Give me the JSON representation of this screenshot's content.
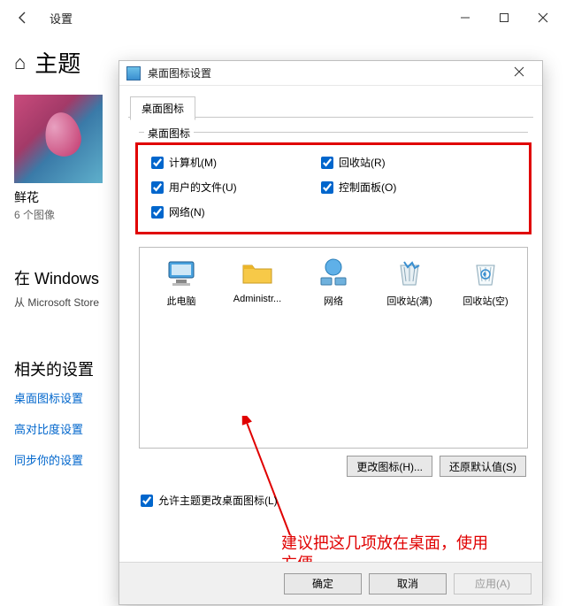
{
  "settings": {
    "title": "设置",
    "page_heading": "主题",
    "thumb_caption": "鲜花",
    "thumb_sub": "6 个图像",
    "section_heading": "在 Windows",
    "section_sub": "从 Microsoft Store",
    "related_heading": "相关的设置",
    "links": {
      "desktop_icons": "桌面图标设置",
      "high_contrast": "高对比度设置",
      "sync": "同步你的设置"
    }
  },
  "dialog": {
    "title": "桌面图标设置",
    "tab": "桌面图标",
    "group_title": "桌面图标",
    "checks": {
      "computer": "计算机(M)",
      "user_files": "用户的文件(U)",
      "network": "网络(N)",
      "recycle_bin": "回收站(R)",
      "control_panel": "控制面板(O)"
    },
    "icon_labels": {
      "this_pc": "此电脑",
      "admin": "Administr...",
      "network": "网络",
      "recycle_full": "回收站(满)",
      "recycle_empty": "回收站(空)"
    },
    "buttons": {
      "change_icon": "更改图标(H)...",
      "restore_default": "还原默认值(S)",
      "ok": "确定",
      "cancel": "取消",
      "apply": "应用(A)"
    },
    "allow_theme": "允许主题更改桌面图标(L)"
  },
  "annotation": "建议把这几项放在桌面，使用方便"
}
